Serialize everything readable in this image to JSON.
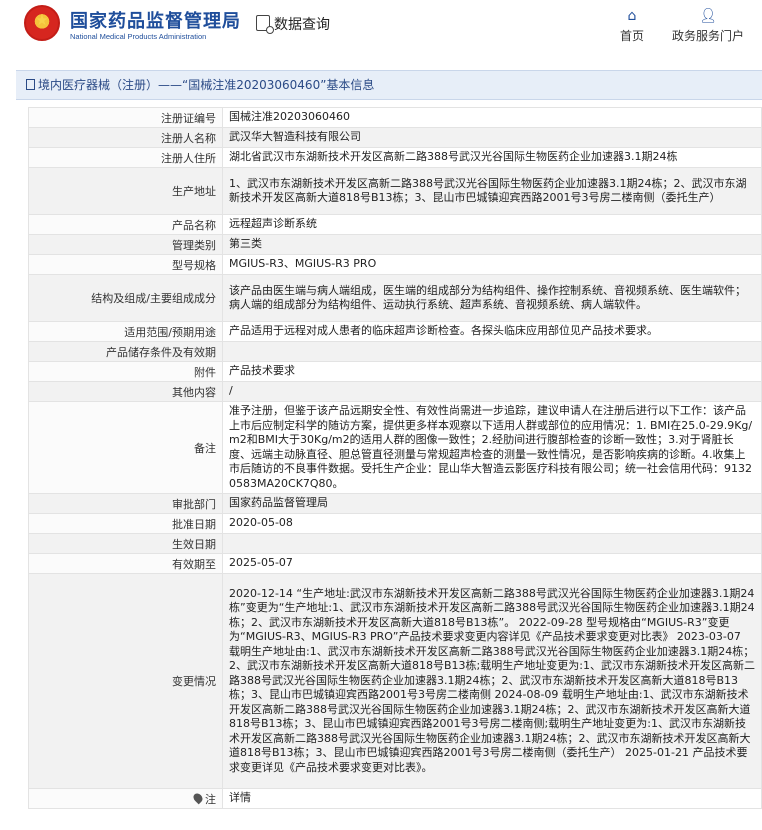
{
  "header": {
    "brand_cn": "国家药品监督管理局",
    "brand_en": "National Medical Products Administration",
    "data_search": "数据查询",
    "nav": [
      {
        "label": "首页",
        "icon": "home-icon"
      },
      {
        "label": "政务服务门户",
        "icon": "user-icon"
      }
    ]
  },
  "breadcrumb": "境内医疗器械（注册）——“国械注准20203060460”基本信息",
  "rows": [
    {
      "label": "注册证编号",
      "value": "国械注准20203060460"
    },
    {
      "label": "注册人名称",
      "value": "武汉华大智造科技有限公司"
    },
    {
      "label": "注册人住所",
      "value": "湖北省武汉市东湖新技术开发区高新二路388号武汉光谷国际生物医药企业加速器3.1期24栋"
    },
    {
      "label": "生产地址",
      "value": "1、武汉市东湖新技术开发区高新二路388号武汉光谷国际生物医药企业加速器3.1期24栋；2、武汉市东湖新技术开发区高新大道818号B13栋；3、昆山市巴城镇迎宾西路2001号3号房二楼南侧（委托生产）"
    },
    {
      "label": "产品名称",
      "value": "远程超声诊断系统"
    },
    {
      "label": "管理类别",
      "value": "第三类"
    },
    {
      "label": "型号规格",
      "value": "MGIUS-R3、MGIUS-R3 PRO"
    },
    {
      "label": "结构及组成/主要组成成分",
      "value": "该产品由医生端与病人端组成，医生端的组成部分为结构组件、操作控制系统、音视频系统、医生端软件；病人端的组成部分为结构组件、运动执行系统、超声系统、音视频系统、病人端软件。"
    },
    {
      "label": "适用范围/预期用途",
      "value": "产品适用于远程对成人患者的临床超声诊断检查。各探头临床应用部位见产品技术要求。"
    },
    {
      "label": "产品储存条件及有效期",
      "value": ""
    },
    {
      "label": "附件",
      "value": "产品技术要求"
    },
    {
      "label": "其他内容",
      "value": "/"
    },
    {
      "label": "备注",
      "value": "准予注册，但鉴于该产品远期安全性、有效性尚需进一步追踪，建议申请人在注册后进行以下工作：该产品上市后应制定科学的随访方案，提供更多样本观察以下适用人群或部位的应用情况：1. BMI在25.0-29.9Kg/m2和BMI大于30Kg/m2的适用人群的图像一致性；2.经肋间进行腹部检查的诊断一致性；3.对于肾脏长度、远端主动脉直径、胆总管直径测量与常规超声检查的测量一致性情况，是否影响疾病的诊断。4.收集上市后随访的不良事件数据。受托生产企业：昆山华大智造云影医疗科技有限公司；统一社会信用代码：91320583MA20CK7Q80。"
    },
    {
      "label": "审批部门",
      "value": "国家药品监督管理局"
    },
    {
      "label": "批准日期",
      "value": "2020-05-08"
    },
    {
      "label": "生效日期",
      "value": ""
    },
    {
      "label": "有效期至",
      "value": "2025-05-07"
    },
    {
      "label": "变更情况",
      "value": "2020-12-14 “生产地址:武汉市东湖新技术开发区高新二路388号武汉光谷国际生物医药企业加速器3.1期24栋”变更为“生产地址:1、武汉市东湖新技术开发区高新二路388号武汉光谷国际生物医药企业加速器3.1期24栋；2、武汉市东湖新技术开发区高新大道818号B13栋”。 2022-09-28 型号规格由“MGIUS-R3”变更为“MGIUS-R3、MGIUS-R3 PRO”产品技术要求变更内容详见《产品技术要求变更对比表》 2023-03-07 载明生产地址由:1、武汉市东湖新技术开发区高新二路388号武汉光谷国际生物医药企业加速器3.1期24栋；2、武汉市东湖新技术开发区高新大道818号B13栋;载明生产地址变更为:1、武汉市东湖新技术开发区高新二路388号武汉光谷国际生物医药企业加速器3.1期24栋；2、武汉市东湖新技术开发区高新大道818号B13栋；3、昆山市巴城镇迎宾西路2001号3号房二楼南侧 2024-08-09 载明生产地址由:1、武汉市东湖新技术开发区高新二路388号武汉光谷国际生物医药企业加速器3.1期24栋；2、武汉市东湖新技术开发区高新大道818号B13栋；3、昆山市巴城镇迎宾西路2001号3号房二楼南侧;载明生产地址变更为:1、武汉市东湖新技术开发区高新二路388号武汉光谷国际生物医药企业加速器3.1期24栋；2、武汉市东湖新技术开发区高新大道818号B13栋；3、昆山市巴城镇迎宾西路2001号3号房二楼南侧（委托生产） 2025-01-21 产品技术要求变更详见《产品技术要求变更对比表》。"
    },
    {
      "label": "注",
      "value": "详情"
    }
  ]
}
